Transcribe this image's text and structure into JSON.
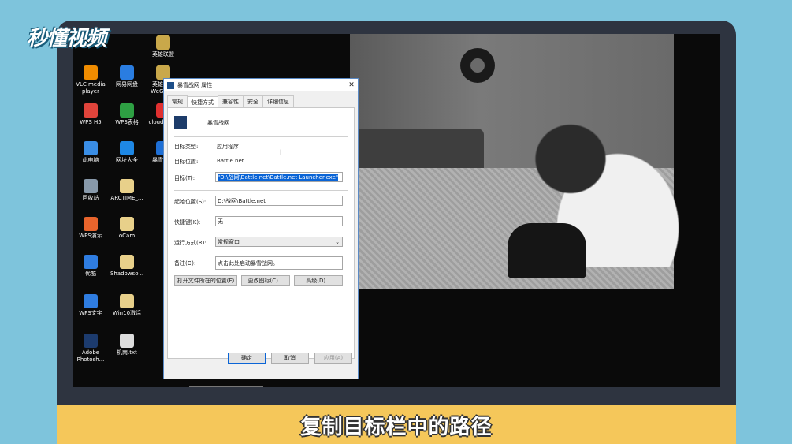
{
  "brand": "秒懂视频",
  "desktop_icons": [
    {
      "label": "英雄联盟",
      "icon": "lol-icon",
      "color": "#c9a84a"
    },
    {
      "label": "VLC media player",
      "icon": "vlc-icon",
      "color": "#f08c00"
    },
    {
      "label": "网易网盘",
      "icon": "netdisk-icon",
      "color": "#2a7de1"
    },
    {
      "label": "英雄联盟 WeGame",
      "icon": "wegame-icon",
      "color": "#c9a84a"
    },
    {
      "label": "WPS H5",
      "icon": "wps-h5-icon",
      "color": "#e0443b"
    },
    {
      "label": "WPS表格",
      "icon": "wps-sheet-icon",
      "color": "#2ea043"
    },
    {
      "label": "cloudmu...",
      "icon": "cloudmusic-icon",
      "color": "#e03030"
    },
    {
      "label": "此电脑",
      "icon": "computer-icon",
      "color": "#3a8ee6"
    },
    {
      "label": "网址大全",
      "icon": "ie-icon",
      "color": "#1e88e5"
    },
    {
      "label": "暴雪战网",
      "icon": "battlenet-icon",
      "color": "#1e6fd6"
    },
    {
      "label": "回收站",
      "icon": "recycle-bin-icon",
      "color": "#8899aa"
    },
    {
      "label": "ARCTIME_...",
      "icon": "file-icon",
      "color": "#e8d08a"
    },
    {
      "label": "WPS演示",
      "icon": "wps-ppt-icon",
      "color": "#e8642c"
    },
    {
      "label": "oCam",
      "icon": "file-icon",
      "color": "#e8d08a"
    },
    {
      "label": "优酷",
      "icon": "youku-icon",
      "color": "#2f7de1"
    },
    {
      "label": "Shadowso...",
      "icon": "file-icon",
      "color": "#e8d08a"
    },
    {
      "label": "WPS文字",
      "icon": "wps-doc-icon",
      "color": "#2f7de1"
    },
    {
      "label": "Win10激活",
      "icon": "file-icon",
      "color": "#e8d08a"
    },
    {
      "label": "Adobe Photosh...",
      "icon": "photoshop-icon",
      "color": "#1c3b6e"
    },
    {
      "label": "机南.txt",
      "icon": "txt-icon",
      "color": "#dddddd"
    }
  ],
  "dialog": {
    "title": "暴雪战网 属性",
    "tabs": [
      "常规",
      "快捷方式",
      "兼容性",
      "安全",
      "详细信息"
    ],
    "active_tab": "快捷方式",
    "app_name": "暴雪战网",
    "target_type_label": "目标类型:",
    "target_type_value": "应用程序",
    "target_location_label": "目标位置:",
    "target_location_value": "Battle.net",
    "target_label": "目标(T):",
    "target_value": "\"D:\\战网\\Battle.net\\Battle.net Launcher.exe\"",
    "start_in_label": "起始位置(S):",
    "start_in_value": "D:\\战网\\Battle.net",
    "shortcut_key_label": "快捷键(K):",
    "shortcut_key_value": "无",
    "run_label": "运行方式(R):",
    "run_value": "常规窗口",
    "comment_label": "备注(O):",
    "comment_value": "点击此处启动暴雪战网。",
    "open_location_button": "打开文件所在的位置(F)",
    "change_icon_button": "更改图标(C)...",
    "advanced_button": "高级(D)...",
    "ok_button": "确定",
    "cancel_button": "取消",
    "apply_button": "应用(A)"
  },
  "subtitle": "复制目标栏中的路径"
}
